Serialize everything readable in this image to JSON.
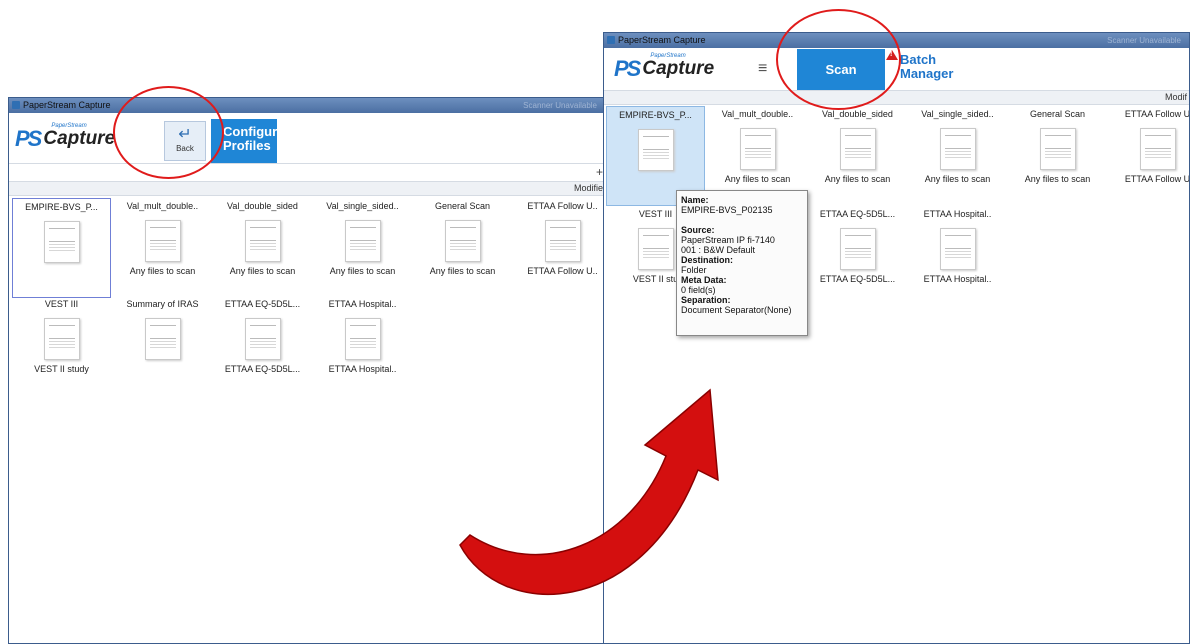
{
  "left_window": {
    "title": "PaperStream Capture",
    "title_dim": "Scanner Unavailable",
    "logo_small": "PaperStream",
    "logo_big": "Capture",
    "back_label": "Back",
    "configure_line1": "Configure",
    "configure_line2": "Profiles",
    "add_icon": "plus-icon",
    "column_header": "Modifie",
    "tiles": [
      {
        "name": "EMPIRE-BVS_P...",
        "sub": ""
      },
      {
        "name": "Val_mult_double..",
        "sub": "Any files to scan"
      },
      {
        "name": "Val_double_sided",
        "sub": "Any files to scan"
      },
      {
        "name": "Val_single_sided..",
        "sub": "Any files to scan"
      },
      {
        "name": "General Scan",
        "sub": "Any files to scan"
      },
      {
        "name": "ETTAA Follow U..",
        "sub": "ETTAA Follow U.."
      },
      {
        "name": "VEST III",
        "sub": "VEST II study"
      },
      {
        "name": "Summary of IRAS",
        "sub": ""
      },
      {
        "name": "ETTAA EQ-5D5L...",
        "sub": "ETTAA EQ-5D5L..."
      },
      {
        "name": "ETTAA Hospital..",
        "sub": "ETTAA Hospital.."
      }
    ]
  },
  "right_window": {
    "title": "PaperStream Capture",
    "title_dim": "Scanner Unavailable",
    "logo_small": "PaperStream",
    "logo_big": "Capture",
    "menu_icon": "hamburger-icon",
    "scan_label": "Scan",
    "warning_icon": "warning-icon",
    "batch_line1": "Batch",
    "batch_line2": "Manager",
    "column_header": "Modif",
    "tiles": [
      {
        "name": "EMPIRE-BVS_P...",
        "sub": ""
      },
      {
        "name": "Val_mult_double..",
        "sub": "Any files to scan"
      },
      {
        "name": "Val_double_sided",
        "sub": "Any files to scan"
      },
      {
        "name": "Val_single_sided..",
        "sub": "Any files to scan"
      },
      {
        "name": "General Scan",
        "sub": "Any files to scan"
      },
      {
        "name": "ETTAA Follow U",
        "sub": "ETTAA Follow U"
      },
      {
        "name": "VEST III",
        "sub": "VEST II stu"
      },
      {
        "name": "",
        "sub": "ETTAA EQ-5D5L..."
      },
      {
        "name": "ETTAA EQ-5D5L...",
        "sub": ""
      },
      {
        "name": "ETTAA Hospital..",
        "sub": "ETTAA Hospital.."
      }
    ],
    "tooltip": {
      "name_label": "Name:",
      "name_value": "EMPIRE-BVS_P02135",
      "source_label": "Source:",
      "source_value1": "PaperStream IP fi-7140",
      "source_value2": "001 : B&W Default",
      "destination_label": "Destination:",
      "destination_value": "Folder",
      "meta_label": "Meta Data:",
      "meta_value": "0 field(s)",
      "separation_label": "Separation:",
      "separation_value": "Document Separator(None)"
    }
  },
  "colors": {
    "accent_blue": "#1f86d6",
    "highlight_red": "#e01b1b",
    "arrow_red": "#d40f0f"
  }
}
